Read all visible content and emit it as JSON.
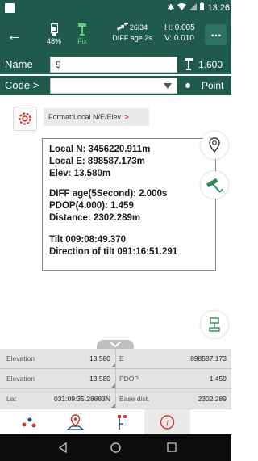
{
  "status_bar": {
    "time": "13:26",
    "icons": [
      "bluetooth-icon",
      "wifi-icon",
      "signal-icon",
      "battery-icon"
    ]
  },
  "toolbar": {
    "battery_percent": "48%",
    "fix_label": "Fix",
    "satellites": "26|34",
    "diff_age": "DIFF age 2s",
    "h_precision": "H: 0.005",
    "v_precision": "V: 0.010",
    "more_label": "..."
  },
  "name_row": {
    "label": "Name",
    "value": "9",
    "antenna_height": "1.600"
  },
  "code_row": {
    "label": "Code",
    "value": "",
    "point_label": "Point"
  },
  "format": {
    "label": "Format:Local N/E/Elev",
    "arrow": ">"
  },
  "info": {
    "local_n": "Local N:  3456220.911m",
    "local_e": "Local E:  898587.173m",
    "elev": "Elev:  13.580m",
    "diff_age_label": "DIFF age(5Second):",
    "diff_age_value": "2.000s",
    "pdop_label": "PDOP(4.000):",
    "pdop_value": "1.459",
    "distance": "Distance:  2302.289m",
    "tilt": "Tilt  009:08:49.370",
    "direction_of_tilt": "Direction of tilt  091:16:51.291"
  },
  "table": {
    "rows": [
      {
        "l_label": "Elevation",
        "l_value": "13.580",
        "r_label": "E",
        "r_value": "898587.173"
      },
      {
        "l_label": "Elevation",
        "l_value": "13.580",
        "r_label": "PDOP",
        "r_value": "1.459"
      },
      {
        "l_label": "Lat",
        "l_value": "031:09:35.28883N",
        "r_label": "Base dist.",
        "r_value": "2302.289"
      }
    ]
  },
  "tabs": [
    "points-icon",
    "map-pin-icon",
    "stakeout-icon",
    "info-icon"
  ],
  "colors": {
    "header_bg": "#1f5a4c",
    "accent_red": "#d8342a",
    "accent_green": "#2e8b57",
    "fix_green": "#5fd07a"
  }
}
